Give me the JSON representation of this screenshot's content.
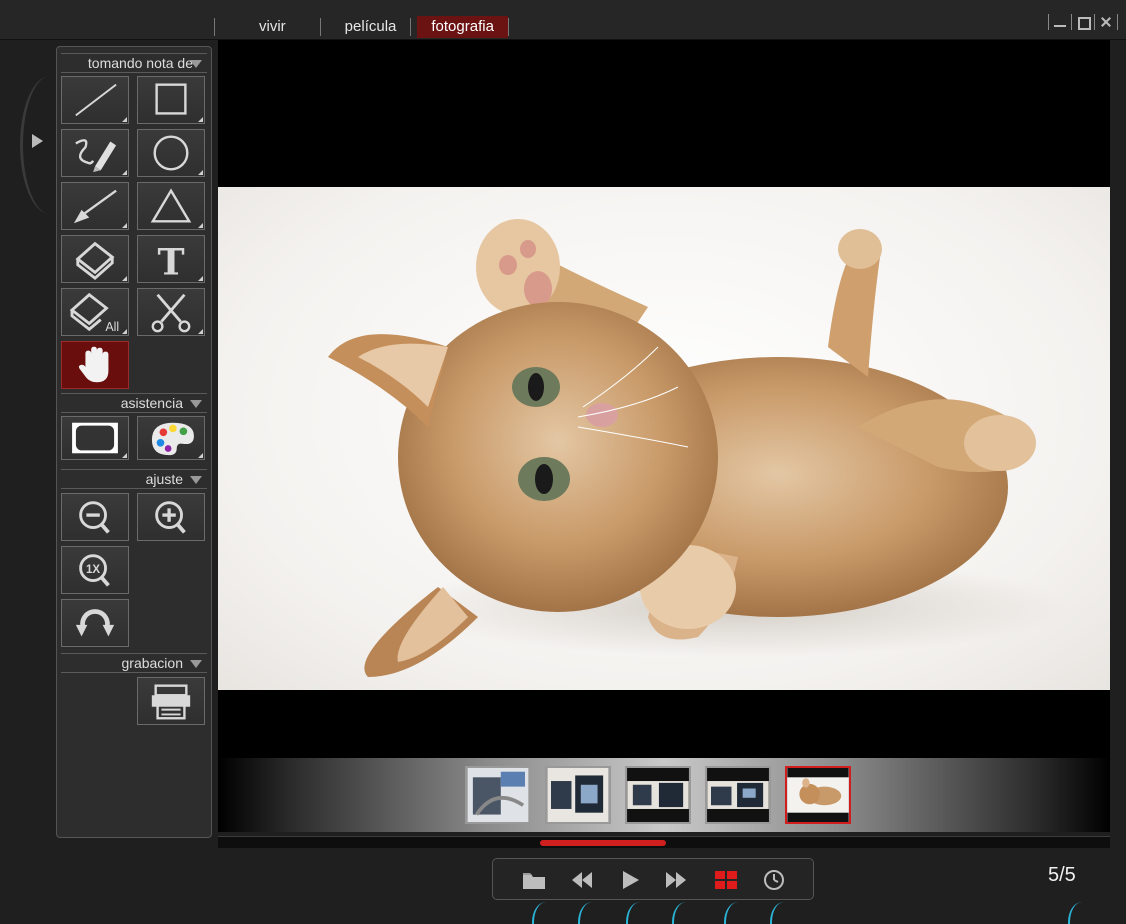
{
  "tabs": [
    {
      "label": "vivir",
      "active": false
    },
    {
      "label": "película",
      "active": false
    },
    {
      "label": "fotografia",
      "active": true
    }
  ],
  "window_controls": [
    "minimize-icon",
    "maximize-icon",
    "close-icon"
  ],
  "panel": {
    "sections": [
      {
        "label": "tomando nota de",
        "tools": [
          "line",
          "rectangle",
          "freehand-pencil",
          "ellipse",
          "arrow",
          "triangle",
          "eraser",
          "text",
          "eraser-all",
          "scissors",
          "hand"
        ]
      },
      {
        "label": "asistencia",
        "tools": [
          "spotlight",
          "palette"
        ]
      },
      {
        "label": "ajuste",
        "tools": [
          "zoom-out",
          "zoom-in",
          "zoom-1x",
          "rotate"
        ]
      },
      {
        "label": "grabacion",
        "tools": [
          "print"
        ]
      }
    ],
    "eraser_all_label": "All",
    "zoom_1x_label": "1X",
    "text_tool_glyph": "T",
    "active_tool": "hand"
  },
  "thumbnails": [
    {
      "name": "photo-1",
      "selected": false
    },
    {
      "name": "photo-2",
      "selected": false
    },
    {
      "name": "photo-3",
      "selected": false
    },
    {
      "name": "photo-4",
      "selected": false
    },
    {
      "name": "photo-5",
      "selected": true
    }
  ],
  "scrollbar_position": 0.42,
  "controls": [
    "folder",
    "rewind",
    "play",
    "fast-forward",
    "grid",
    "clock"
  ],
  "counter": "5/5",
  "colors": {
    "accent": "#6b1212",
    "highlight": "#d11d1d",
    "callout": "#2bb6d8",
    "panel": "#2d2d2d"
  }
}
